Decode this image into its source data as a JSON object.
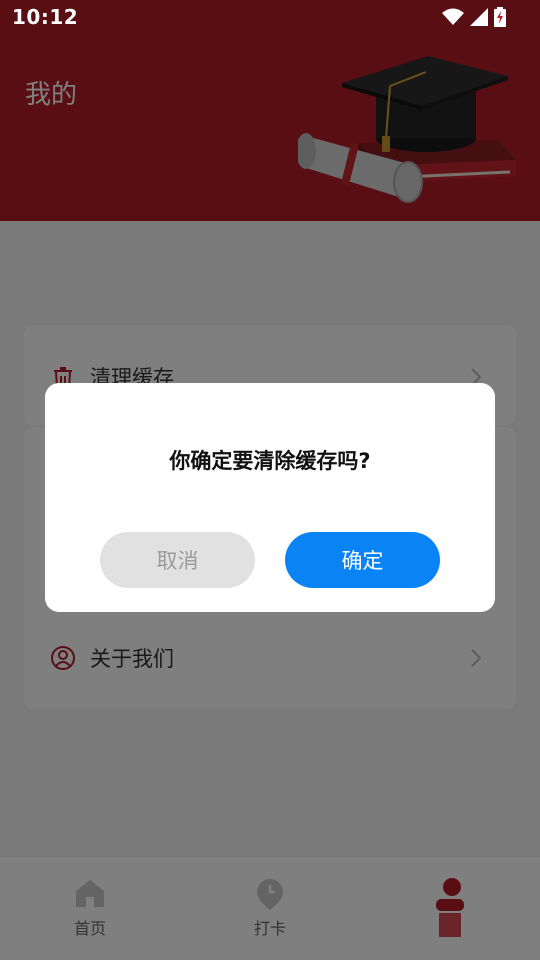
{
  "status_bar": {
    "time": "10:12",
    "icons": [
      "wifi-icon",
      "signal-icon",
      "battery-icon"
    ]
  },
  "header": {
    "title": "我的",
    "illustration": "graduation-cap-book-diploma"
  },
  "menu": {
    "clear_cache": {
      "label": "清理缓存",
      "icon": "trash-icon"
    },
    "about_us": {
      "label": "关于我们",
      "icon": "user-circle-icon"
    }
  },
  "bottom_nav": {
    "items": [
      {
        "label": "首页",
        "icon": "home-icon"
      },
      {
        "label": "打卡",
        "icon": "clock-pin-icon"
      },
      {
        "label": "",
        "icon": "person-icon",
        "active": true
      }
    ]
  },
  "dialog": {
    "message": "你确定要清除缓存吗?",
    "cancel_label": "取消",
    "confirm_label": "确定"
  },
  "colors": {
    "brand_red": "#b31d29",
    "confirm_blue": "#0a84f5",
    "cancel_gray": "#e1e1e1"
  }
}
